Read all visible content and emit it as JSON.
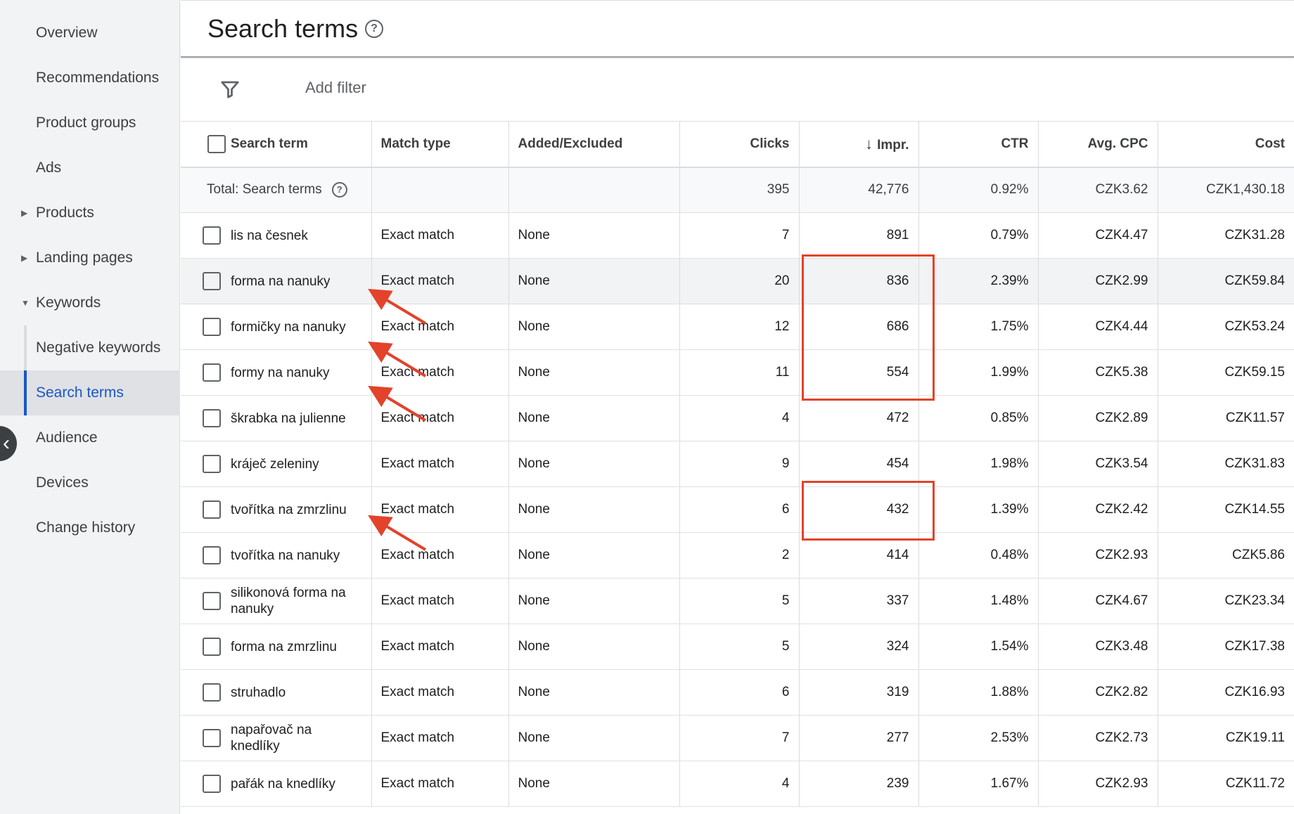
{
  "sidebar": {
    "items": [
      {
        "label": "Overview"
      },
      {
        "label": "Recommendations"
      },
      {
        "label": "Product groups"
      },
      {
        "label": "Ads"
      },
      {
        "label": "Products"
      },
      {
        "label": "Landing pages"
      },
      {
        "label": "Keywords"
      },
      {
        "label": "Negative keywords"
      },
      {
        "label": "Search terms"
      },
      {
        "label": "Audience"
      },
      {
        "label": "Devices"
      },
      {
        "label": "Change history"
      }
    ]
  },
  "header": {
    "title": "Search terms",
    "help_glyph": "?"
  },
  "filter": {
    "add_label": "Add filter"
  },
  "table": {
    "headers": {
      "search_term": "Search term",
      "match_type": "Match type",
      "added_excluded": "Added/Excluded",
      "clicks": "Clicks",
      "impr": "Impr.",
      "ctr": "CTR",
      "avg_cpc": "Avg. CPC",
      "cost": "Cost"
    },
    "sort_glyph": "↓",
    "total": {
      "label": "Total: Search terms",
      "help_glyph": "?",
      "clicks": "395",
      "impr": "42,776",
      "ctr": "0.92%",
      "avg_cpc": "CZK3.62",
      "cost": "CZK1,430.18"
    },
    "rows": [
      {
        "term": "lis na česnek",
        "match": "Exact match",
        "status": "None",
        "clicks": "7",
        "impr": "891",
        "ctr": "0.79%",
        "cpc": "CZK4.47",
        "cost": "CZK31.28"
      },
      {
        "term": "forma na nanuky",
        "match": "Exact match",
        "status": "None",
        "clicks": "20",
        "impr": "836",
        "ctr": "2.39%",
        "cpc": "CZK2.99",
        "cost": "CZK59.84"
      },
      {
        "term": "formičky na nanuky",
        "match": "Exact match",
        "status": "None",
        "clicks": "12",
        "impr": "686",
        "ctr": "1.75%",
        "cpc": "CZK4.44",
        "cost": "CZK53.24"
      },
      {
        "term": "formy na nanuky",
        "match": "Exact match",
        "status": "None",
        "clicks": "11",
        "impr": "554",
        "ctr": "1.99%",
        "cpc": "CZK5.38",
        "cost": "CZK59.15"
      },
      {
        "term": "škrabka na julienne",
        "match": "Exact match",
        "status": "None",
        "clicks": "4",
        "impr": "472",
        "ctr": "0.85%",
        "cpc": "CZK2.89",
        "cost": "CZK11.57"
      },
      {
        "term": "kráječ zeleniny",
        "match": "Exact match",
        "status": "None",
        "clicks": "9",
        "impr": "454",
        "ctr": "1.98%",
        "cpc": "CZK3.54",
        "cost": "CZK31.83"
      },
      {
        "term": "tvořítka na zmrzlinu",
        "match": "Exact match",
        "status": "None",
        "clicks": "6",
        "impr": "432",
        "ctr": "1.39%",
        "cpc": "CZK2.42",
        "cost": "CZK14.55"
      },
      {
        "term": "tvořítka na nanuky",
        "match": "Exact match",
        "status": "None",
        "clicks": "2",
        "impr": "414",
        "ctr": "0.48%",
        "cpc": "CZK2.93",
        "cost": "CZK5.86"
      },
      {
        "term": "silikonová forma na nanuky",
        "match": "Exact match",
        "status": "None",
        "clicks": "5",
        "impr": "337",
        "ctr": "1.48%",
        "cpc": "CZK4.67",
        "cost": "CZK23.34"
      },
      {
        "term": "forma na zmrzlinu",
        "match": "Exact match",
        "status": "None",
        "clicks": "5",
        "impr": "324",
        "ctr": "1.54%",
        "cpc": "CZK3.48",
        "cost": "CZK17.38"
      },
      {
        "term": "struhadlo",
        "match": "Exact match",
        "status": "None",
        "clicks": "6",
        "impr": "319",
        "ctr": "1.88%",
        "cpc": "CZK2.82",
        "cost": "CZK16.93"
      },
      {
        "term": "napařovač na knedlíky",
        "match": "Exact match",
        "status": "None",
        "clicks": "7",
        "impr": "277",
        "ctr": "2.53%",
        "cpc": "CZK2.73",
        "cost": "CZK19.11"
      },
      {
        "term": "pařák na knedlíky",
        "match": "Exact match",
        "status": "None",
        "clicks": "4",
        "impr": "239",
        "ctr": "1.67%",
        "cpc": "CZK2.93",
        "cost": "CZK11.72"
      }
    ]
  },
  "annotations": {
    "color": "#e2432a",
    "icons": [
      "red-arrow",
      "red-highlight-box"
    ]
  }
}
